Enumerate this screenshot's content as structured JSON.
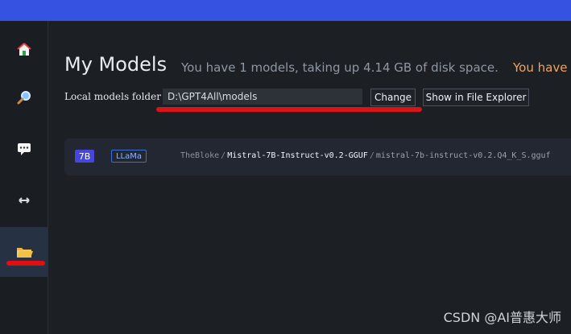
{
  "sidebar": {
    "items": [
      {
        "name": "home",
        "icon": "home-icon"
      },
      {
        "name": "search",
        "icon": "search-icon"
      },
      {
        "name": "chat",
        "icon": "chat-icon"
      },
      {
        "name": "resize",
        "icon": "resize-icon"
      },
      {
        "name": "models",
        "icon": "folder-icon",
        "active": true
      }
    ]
  },
  "header": {
    "title": "My Models",
    "subtitle": "You have 1 models, taking up 4.14 GB of disk space.",
    "subtitle_warning": "You have"
  },
  "folder": {
    "label": "Local models folder",
    "value": "D:\\GPT4All\\models",
    "change_label": "Change",
    "explorer_label": "Show in File Explorer"
  },
  "models": [
    {
      "size_badge": "7B",
      "type_badge": "LLaMa",
      "author": "TheBloke",
      "repo": "Mistral-7B-Instruct-v0.2-GGUF",
      "file": "mistral-7b-instruct-v0.2.Q4_K_S.gguf"
    }
  ],
  "watermark": "CSDN @AI普惠大师"
}
